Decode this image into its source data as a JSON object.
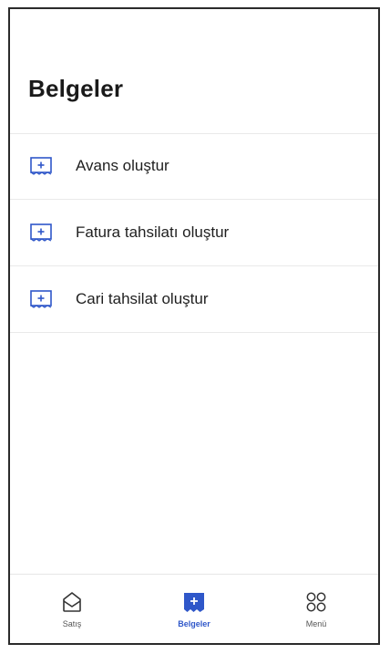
{
  "header": {
    "title": "Belgeler"
  },
  "list": {
    "items": [
      {
        "label": "Avans oluştur",
        "icon": "document-plus-icon"
      },
      {
        "label": "Fatura tahsilatı oluştur",
        "icon": "document-plus-icon"
      },
      {
        "label": "Cari tahsilat oluştur",
        "icon": "document-plus-icon"
      }
    ]
  },
  "bottom_nav": {
    "items": [
      {
        "label": "Satış",
        "icon": "home-icon",
        "active": false
      },
      {
        "label": "Belgeler",
        "icon": "document-plus-icon",
        "active": true
      },
      {
        "label": "Menü",
        "icon": "grid-circles-icon",
        "active": false
      }
    ]
  },
  "colors": {
    "accent": "#2f57c9",
    "text": "#1f1f1f",
    "divider": "#e9e9e9"
  }
}
